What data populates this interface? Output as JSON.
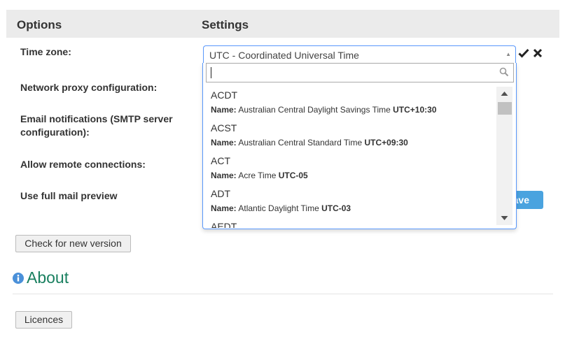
{
  "header": {
    "options_label": "Options",
    "settings_label": "Settings"
  },
  "labels": {
    "time_zone": "Time zone:",
    "network_proxy": "Network proxy configuration:",
    "email_notifications": "Email notifications (SMTP server configuration):",
    "allow_remote": "Allow remote connections:",
    "full_mail_preview": "Use full mail preview"
  },
  "timezone_select": {
    "selected_value": "UTC - Coordinated Universal Time",
    "search_value": "",
    "arrow_icon": "triangle-up-icon"
  },
  "timezone_options": [
    {
      "code": "ACDT",
      "name_label": "Name:",
      "name": "Australian Central Daylight Savings Time",
      "offset": "UTC+10:30"
    },
    {
      "code": "ACST",
      "name_label": "Name:",
      "name": "Australian Central Standard Time",
      "offset": "UTC+09:30"
    },
    {
      "code": "ACT",
      "name_label": "Name:",
      "name": "Acre Time",
      "offset": "UTC-05"
    },
    {
      "code": "ADT",
      "name_label": "Name:",
      "name": "Atlantic Daylight Time",
      "offset": "UTC-03"
    },
    {
      "code": "AEDT",
      "name_label": "",
      "name": "",
      "offset": ""
    }
  ],
  "icons": {
    "confirm": "checkmark-icon",
    "cancel": "close-icon",
    "search": "search-icon",
    "info": "info-icon"
  },
  "buttons": {
    "save_partial": "ave",
    "check_version": "Check for new version",
    "licences": "Licences"
  },
  "about": {
    "title": "About"
  },
  "colors": {
    "header_bg": "#ebebeb",
    "focus_border": "#5897fb",
    "save_button": "#4aa3df",
    "about_title": "#1a8060",
    "info_icon": "#4a90d9"
  }
}
